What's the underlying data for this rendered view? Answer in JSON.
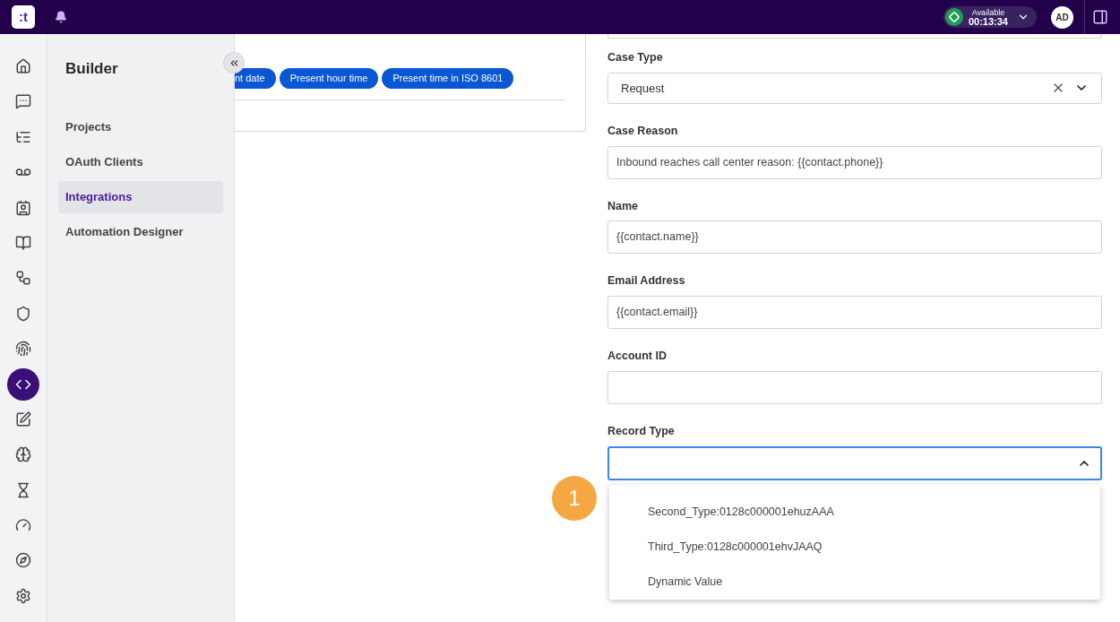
{
  "topbar": {
    "logo": ":t",
    "status": {
      "label": "Available",
      "timer": "00:13:34"
    },
    "avatar": "AD"
  },
  "rail": [
    {
      "kind": "home",
      "selected": false
    },
    {
      "kind": "agent",
      "selected": false
    },
    {
      "kind": "list",
      "selected": false
    },
    {
      "kind": "voicemail",
      "selected": false
    },
    {
      "kind": "contact",
      "selected": false
    },
    {
      "kind": "book",
      "selected": false
    },
    {
      "kind": "flow",
      "selected": false
    },
    {
      "kind": "shield",
      "selected": false
    },
    {
      "kind": "fingerprint",
      "selected": false
    },
    {
      "kind": "code",
      "selected": true
    },
    {
      "kind": "edit",
      "selected": false
    },
    {
      "kind": "brain",
      "selected": false
    },
    {
      "kind": "hourglass",
      "selected": false
    },
    {
      "kind": "gauge",
      "selected": false
    },
    {
      "kind": "compass",
      "selected": false
    },
    {
      "kind": "settings",
      "selected": false
    }
  ],
  "builder": {
    "title": "Builder",
    "items": [
      {
        "label": "Projects",
        "selected": false
      },
      {
        "label": "OAuth Clients",
        "selected": false
      },
      {
        "label": "Integrations",
        "selected": true
      },
      {
        "label": "Automation Designer",
        "selected": false
      }
    ]
  },
  "chips": [
    "nt date",
    "Present hour time",
    "Present time in ISO 8601"
  ],
  "form": [
    {
      "label": "Case Type",
      "kind": "select",
      "value": "Request"
    },
    {
      "label": "Case Reason",
      "kind": "text",
      "value": "Inbound reaches call center reason: {{contact.phone}}"
    },
    {
      "label": "Name",
      "kind": "text",
      "value": "{{contact.name}}"
    },
    {
      "label": "Email Address",
      "kind": "text",
      "value": "{{contact.email}}"
    },
    {
      "label": "Account ID",
      "kind": "text"
    },
    {
      "label": "Record Type",
      "kind": "open-select"
    }
  ],
  "dropdown_options": [
    "Second_Type:0128c000001ehuzAAA",
    "Third_Type:0128c000001ehvJAAQ",
    "Dynamic Value"
  ],
  "step_badge": "1"
}
